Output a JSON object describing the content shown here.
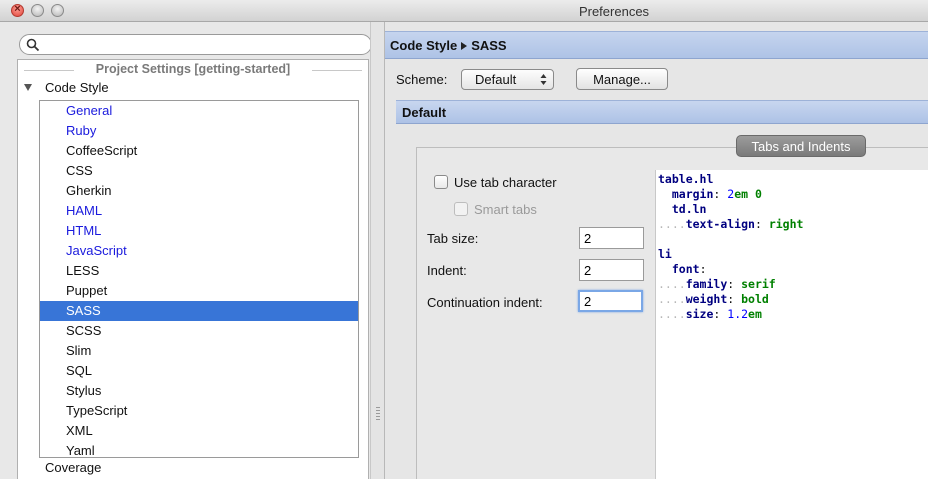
{
  "window": {
    "title": "Preferences"
  },
  "search": {
    "placeholder": ""
  },
  "tree": {
    "group_header": "Project Settings [getting-started]",
    "code_style_label": "Code Style",
    "items": [
      {
        "label": "General",
        "blue": true
      },
      {
        "label": "Ruby",
        "blue": true
      },
      {
        "label": "CoffeeScript",
        "blue": false
      },
      {
        "label": "CSS",
        "blue": false
      },
      {
        "label": "Gherkin",
        "blue": false
      },
      {
        "label": "HAML",
        "blue": true
      },
      {
        "label": "HTML",
        "blue": true
      },
      {
        "label": "JavaScript",
        "blue": true
      },
      {
        "label": "LESS",
        "blue": false
      },
      {
        "label": "Puppet",
        "blue": false
      },
      {
        "label": "SASS",
        "blue": false,
        "selected": true
      },
      {
        "label": "SCSS",
        "blue": false
      },
      {
        "label": "Slim",
        "blue": false
      },
      {
        "label": "SQL",
        "blue": false
      },
      {
        "label": "Stylus",
        "blue": false
      },
      {
        "label": "TypeScript",
        "blue": false
      },
      {
        "label": "XML",
        "blue": false
      },
      {
        "label": "Yaml",
        "blue": false
      }
    ],
    "coverage_label": "Coverage"
  },
  "breadcrumb": {
    "parent": "Code Style",
    "current": "SASS"
  },
  "scheme": {
    "label": "Scheme:",
    "value": "Default",
    "manage_label": "Manage..."
  },
  "section": {
    "title": "Default"
  },
  "tab": {
    "title": "Tabs and Indents"
  },
  "options": {
    "use_tab_label": "Use tab character",
    "smart_tabs_label": "Smart tabs",
    "tab_size_label": "Tab size:",
    "tab_size_value": "2",
    "indent_label": "Indent:",
    "indent_value": "2",
    "continuation_label": "Continuation indent:",
    "continuation_value": "2"
  },
  "preview": {
    "l1": "table.hl",
    "l2_key": "margin",
    "l2_num": "2",
    "l2_unit": "em 0",
    "l3": "td.ln",
    "l4_key": "text-align",
    "l4_val": "right",
    "l5": "li",
    "l6_key": "font",
    "l7_key": "family",
    "l7_val": "serif",
    "l8_key": "weight",
    "l8_val": "bold",
    "l9_key": "size",
    "l9_num": "1.2",
    "l9_unit": "em"
  },
  "colors": {
    "selection": "#3875d7",
    "link_blue": "#1a1add",
    "header_blue": "#aec3e6"
  }
}
